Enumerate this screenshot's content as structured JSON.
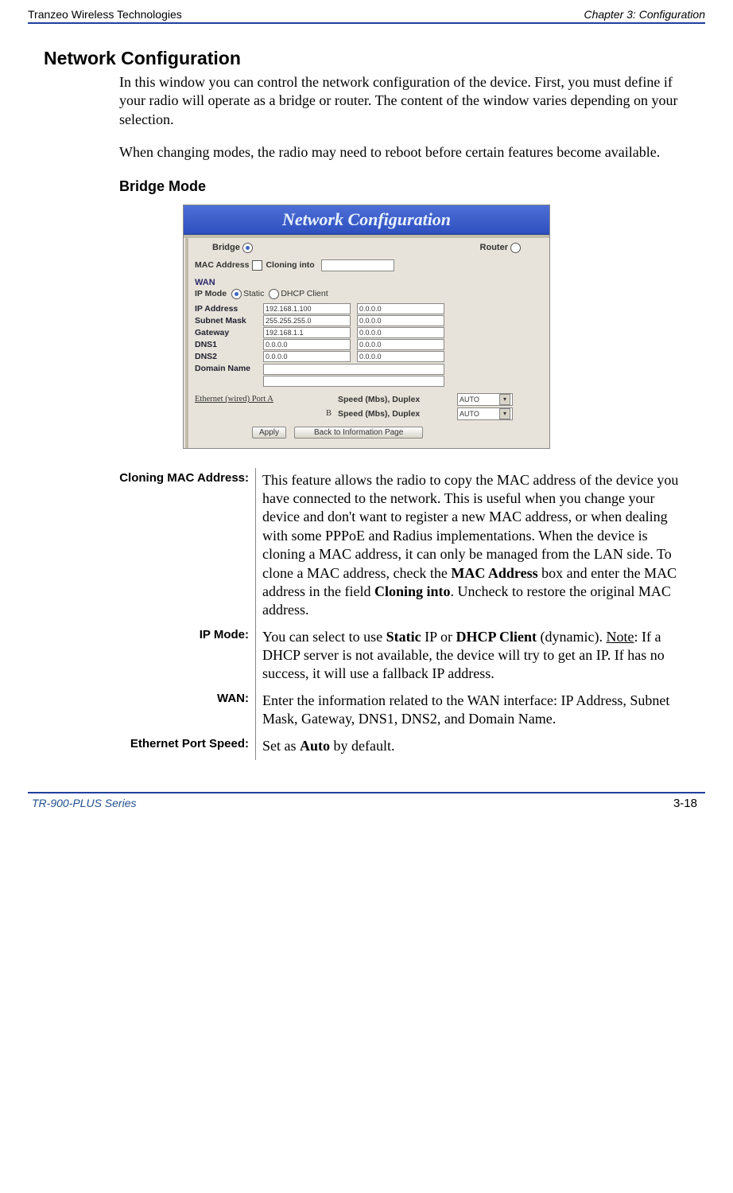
{
  "header": {
    "left": "Tranzeo Wireless Technologies",
    "right": "Chapter 3: Configuration"
  },
  "section": {
    "title": "Network Configuration",
    "para1": "In this window you can control the network configuration of the device. First, you must define if your radio will operate as a bridge or router. The content of the window varies depending on your selection.",
    "para2": "When changing modes, the radio may need to reboot before certain features become available.",
    "subheading": "Bridge Mode"
  },
  "screenshot": {
    "banner": "Network Configuration",
    "bridge_label": "Bridge",
    "router_label": "Router",
    "mac_address_label": "MAC Address",
    "cloning_into_label": "Cloning into",
    "wan_label": "WAN",
    "ip_mode_label": "IP Mode",
    "static_label": "Static",
    "dhcp_client_label": "DHCP Client",
    "fields": {
      "ip_address": {
        "label": "IP Address",
        "v1": "192.168.1.100",
        "v2": "0.0.0.0"
      },
      "subnet_mask": {
        "label": "Subnet Mask",
        "v1": "255.255.255.0",
        "v2": "0.0.0.0"
      },
      "gateway": {
        "label": "Gateway",
        "v1": "192.168.1.1",
        "v2": "0.0.0.0"
      },
      "dns1": {
        "label": "DNS1",
        "v1": "0.0.0.0",
        "v2": "0.0.0.0"
      },
      "dns2": {
        "label": "DNS2",
        "v1": "0.0.0.0",
        "v2": "0.0.0.0"
      },
      "domain_name": {
        "label": "Domain Name"
      }
    },
    "eth_port_label_a": "Ethernet (wired) Port A",
    "eth_port_label_b": "B",
    "speed_label": "Speed (Mbs), Duplex",
    "select_value": "AUTO",
    "apply_btn": "Apply",
    "back_btn": "Back to Information Page"
  },
  "definitions": {
    "cloning_label": "Cloning MAC Address:",
    "cloning_text_1": "This feature allows the radio to copy the MAC address of the device you have connected to the network. This is useful when you change your device and don't want to register a new MAC address, or when dealing with some PPPoE and Radius implementations. When the device is cloning a MAC address, it can only be managed from the LAN side. To clone a MAC address, check the ",
    "cloning_bold_1": "MAC Address",
    "cloning_text_2": " box and enter the MAC address in the field ",
    "cloning_bold_2": "Cloning into",
    "cloning_text_3": ". Uncheck to restore the original MAC address.",
    "ipmode_label": "IP Mode:",
    "ipmode_text_1": "You can select to use ",
    "ipmode_bold_1": "Static",
    "ipmode_text_2": " IP or ",
    "ipmode_bold_2": "DHCP Client",
    "ipmode_text_3": " (dynamic). ",
    "ipmode_underline": "Note",
    "ipmode_text_4": ": If a DHCP server is not available, the device will try to get an IP. If has no success, it will use a fallback IP address.",
    "wan_label": "WAN:",
    "wan_text": "Enter the information related to the WAN interface: IP Address, Subnet Mask, Gateway, DNS1, DNS2, and Domain Name.",
    "eth_label": "Ethernet Port Speed:",
    "eth_text_1": "Set as ",
    "eth_bold": "Auto",
    "eth_text_2": " by default."
  },
  "footer": {
    "left": "TR-900-PLUS Series",
    "right": "3-18"
  }
}
